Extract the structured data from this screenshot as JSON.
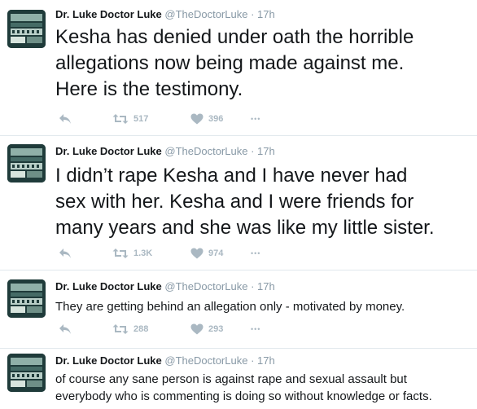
{
  "colors": {
    "text": "#14171a",
    "muted": "#8899a6",
    "icon": "#aab8c2",
    "divider": "#e1e8ed"
  },
  "icons": {
    "reply": "reply-arrow-icon",
    "retweet": "retweet-icon",
    "like": "heart-icon",
    "more": "more-dots-icon"
  },
  "tweets": [
    {
      "name": "Dr. Luke Doctor Luke",
      "handle": "@TheDoctorLuke",
      "dot": "·",
      "time": "17h",
      "text": "Kesha has denied under oath the horrible\nallegations now being made against me.\nHere is the testimony.",
      "retweets": "517",
      "likes": "396",
      "more": "•••"
    },
    {
      "name": "Dr. Luke Doctor Luke",
      "handle": "@TheDoctorLuke",
      "dot": "·",
      "time": "17h",
      "text": "I didn’t rape Kesha and I have never had\nsex with her.  Kesha and I were friends for\nmany years and she was like my little sister.",
      "retweets": "1.3K",
      "likes": "974",
      "more": "•••"
    },
    {
      "name": "Dr. Luke Doctor Luke",
      "handle": "@TheDoctorLuke",
      "dot": "·",
      "time": "17h",
      "text": "They are getting behind an allegation only - motivated by money.",
      "retweets": "288",
      "likes": "293",
      "more": "•••"
    },
    {
      "name": "Dr. Luke Doctor Luke",
      "handle": "@TheDoctorLuke",
      "dot": "·",
      "time": "17h",
      "text": "of course any sane person is against rape and sexual assault but\neverybody who is commenting is doing so without knowledge or facts."
    }
  ]
}
